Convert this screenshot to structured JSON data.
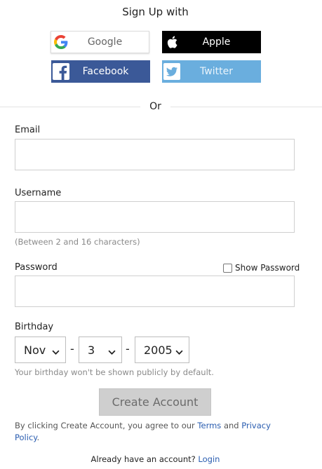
{
  "header": {
    "title": "Sign Up with"
  },
  "social": {
    "google": "Google",
    "apple": "Apple",
    "facebook": "Facebook",
    "twitter": "Twitter"
  },
  "divider": {
    "or": "Or"
  },
  "form": {
    "email": {
      "label": "Email",
      "value": ""
    },
    "username": {
      "label": "Username",
      "value": "",
      "hint": "(Between 2 and 16 characters)"
    },
    "password": {
      "label": "Password",
      "value": "",
      "show_label": "Show Password",
      "show_checked": false
    },
    "birthday": {
      "label": "Birthday",
      "month": "Nov",
      "day": "3",
      "year": "2005",
      "separator": "-",
      "hint": "Your birthday won't be shown publicly by default."
    },
    "submit": "Create Account"
  },
  "legal": {
    "prefix": "By clicking Create Account, you agree to our ",
    "terms": "Terms",
    "and": " and ",
    "privacy": "Privacy Policy",
    "suffix": "."
  },
  "footer": {
    "text": "Already have an account? ",
    "login": "Login"
  },
  "colors": {
    "facebook": "#3b5998",
    "twitter": "#6aaede",
    "apple": "#000000",
    "link": "#2a5db0",
    "button_disabled": "#cfcfcf"
  },
  "icons": [
    "google-icon",
    "apple-icon",
    "facebook-icon",
    "twitter-icon",
    "chevron-down-icon"
  ]
}
